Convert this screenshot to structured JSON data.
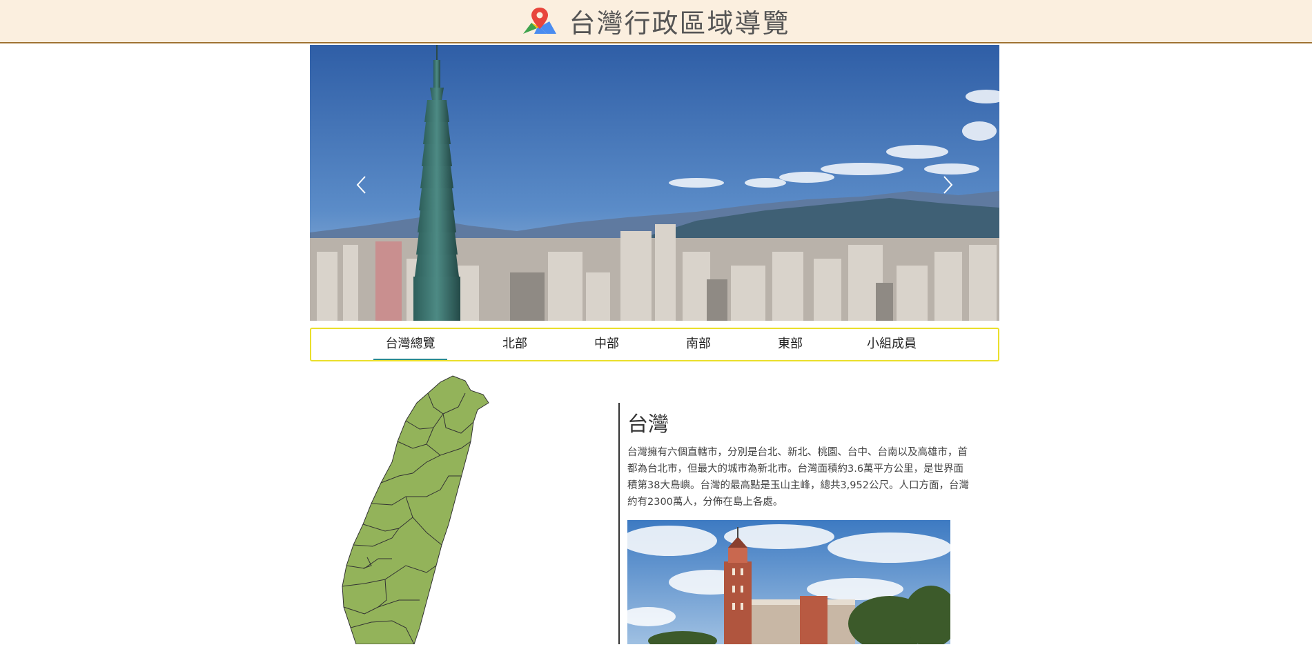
{
  "header": {
    "title": "台灣行政區域導覽",
    "logo_icon": "map-pin-logo-icon",
    "background": "#fbefdf",
    "border_color": "#a07232"
  },
  "carousel": {
    "prev_icon": "chevron-left-icon",
    "next_icon": "chevron-right-icon",
    "image": "taipei-101-skyline-photo"
  },
  "nav": {
    "tabs": [
      {
        "label": "台灣總覽",
        "active": true
      },
      {
        "label": "北部",
        "active": false
      },
      {
        "label": "中部",
        "active": false
      },
      {
        "label": "南部",
        "active": false
      },
      {
        "label": "東部",
        "active": false
      },
      {
        "label": "小組成員",
        "active": false
      }
    ],
    "border_color": "#eadf2b",
    "active_color": "#2a8a8a"
  },
  "map": {
    "image": "taiwan-county-map",
    "fill_color": "#93b35a"
  },
  "info": {
    "heading": "台灣",
    "paragraph": "台灣擁有六個直轄市，分別是台北、新北、桃園、台中、台南以及高雄市，首都為台北市，但最大的城市為新北市。台灣面積約3.6萬平方公里，是世界面積第38大島嶼。台灣的最高點是玉山主峰，總共3,952公尺。人口方面，台灣約有2300萬人，分佈在島上各處。",
    "photo": "presidential-office-building-photo"
  }
}
